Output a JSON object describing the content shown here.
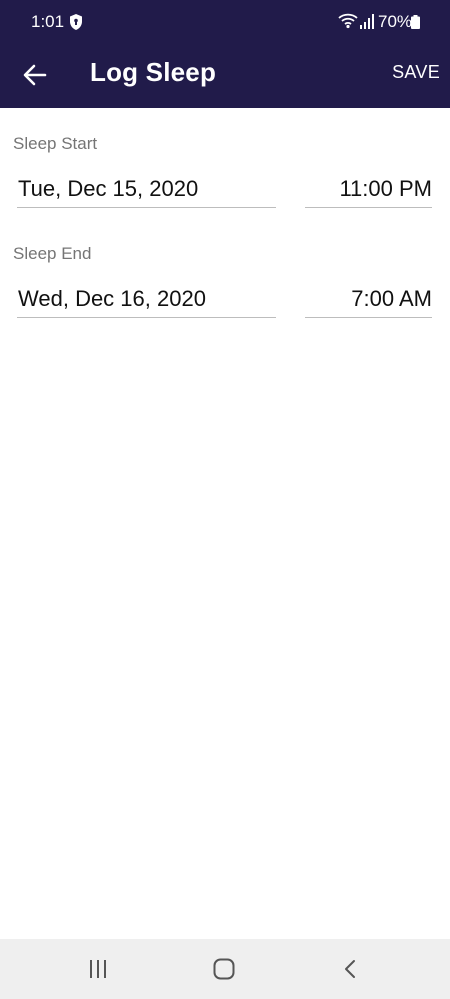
{
  "status_bar": {
    "time": "1:01",
    "battery": "70%",
    "icons": [
      "shield-icon",
      "wifi-icon",
      "signal-icon",
      "battery-icon"
    ]
  },
  "app_bar": {
    "title": "Log Sleep",
    "save_label": "SAVE",
    "back_icon": "arrow-left-icon",
    "background_color": "#211b4a"
  },
  "sleep_start": {
    "label": "Sleep Start",
    "date": "Tue, Dec 15, 2020",
    "time": "11:00 PM"
  },
  "sleep_end": {
    "label": "Sleep End",
    "date": "Wed, Dec 16, 2020",
    "time": "7:00 AM"
  },
  "nav_bar": {
    "icons": [
      "recent-apps-icon",
      "home-icon",
      "back-icon"
    ]
  }
}
